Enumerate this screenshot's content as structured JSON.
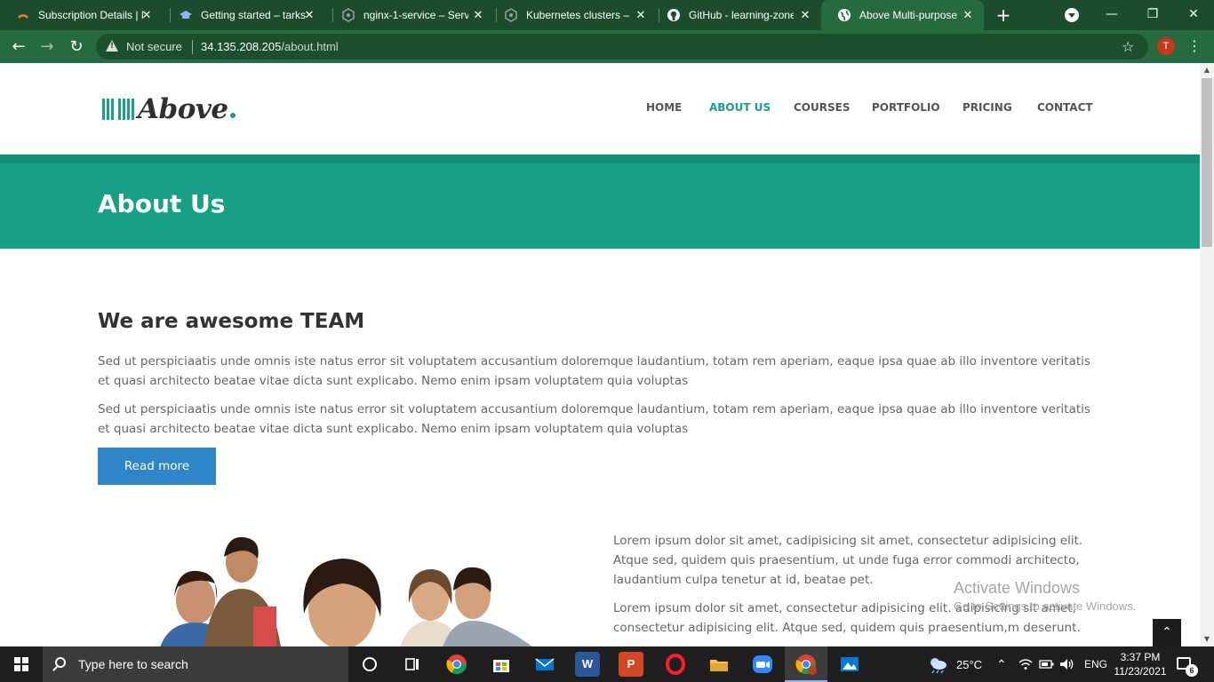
{
  "browser": {
    "tabs": [
      {
        "title": "Subscription Details | M",
        "icon": "subscription-icon",
        "active": false
      },
      {
        "title": "Getting started – tarks",
        "icon": "graduation-cap-icon",
        "active": false
      },
      {
        "title": "nginx-1-service – Serv",
        "icon": "gcp-hexagon-icon",
        "active": false
      },
      {
        "title": "Kubernetes clusters – K",
        "icon": "gcp-hexagon-icon",
        "active": false
      },
      {
        "title": "GitHub - learning-zone",
        "icon": "github-icon",
        "active": false
      },
      {
        "title": "Above Multi-purpose",
        "icon": "globe-icon",
        "active": true
      }
    ],
    "security_label": "Not secure",
    "url_host": "34.135.208.205",
    "url_path": "/about.html",
    "profile_initial": "T"
  },
  "site": {
    "logo_text": "Above",
    "nav": [
      "HOME",
      "ABOUT US",
      "COURSES",
      "PORTFOLIO",
      "PRICING",
      "CONTACT"
    ],
    "active_nav": "ABOUT US",
    "banner_title": "About Us",
    "section_title": "We are awesome TEAM",
    "paragraphs": [
      "Sed ut perspiciaatis unde omnis iste natus error sit voluptatem accusantium doloremque laudantium, totam rem aperiam, eaque ipsa quae ab illo inventore veritatis et quasi architecto beatae vitae dicta sunt explicabo. Nemo enim ipsam voluptatem quia voluptas",
      "Sed ut perspiciaatis unde omnis iste natus error sit voluptatem accusantium doloremque laudantium, totam rem aperiam, eaque ipsa quae ab illo inventore veritatis et quasi architecto beatae vitae dicta sunt explicabo. Nemo enim ipsam voluptatem quia voluptas"
    ],
    "read_more": "Read more",
    "right_paragraphs": [
      "Lorem ipsum dolor sit amet, cadipisicing sit amet, consectetur adipisicing elit. Atque sed, quidem quis praesentium, ut unde fuga error commodi architecto, laudantium culpa tenetur at id, beatae pet.",
      "Lorem ipsum dolor sit amet, consectetur adipisicing elit. adipisicing sit amet, consectetur adipisicing elit. Atque sed, quidem quis praesentium,m deserunt."
    ],
    "accent_color": "#17a085",
    "button_color": "#2e86c9"
  },
  "watermark": {
    "line1": "Activate Windows",
    "line2": "Go to Settings to activate Windows."
  },
  "taskbar": {
    "search_placeholder": "Type here to search",
    "weather": "25°C",
    "language": "ENG",
    "time": "3:37 PM",
    "date": "11/23/2021",
    "notification_count": "6"
  }
}
